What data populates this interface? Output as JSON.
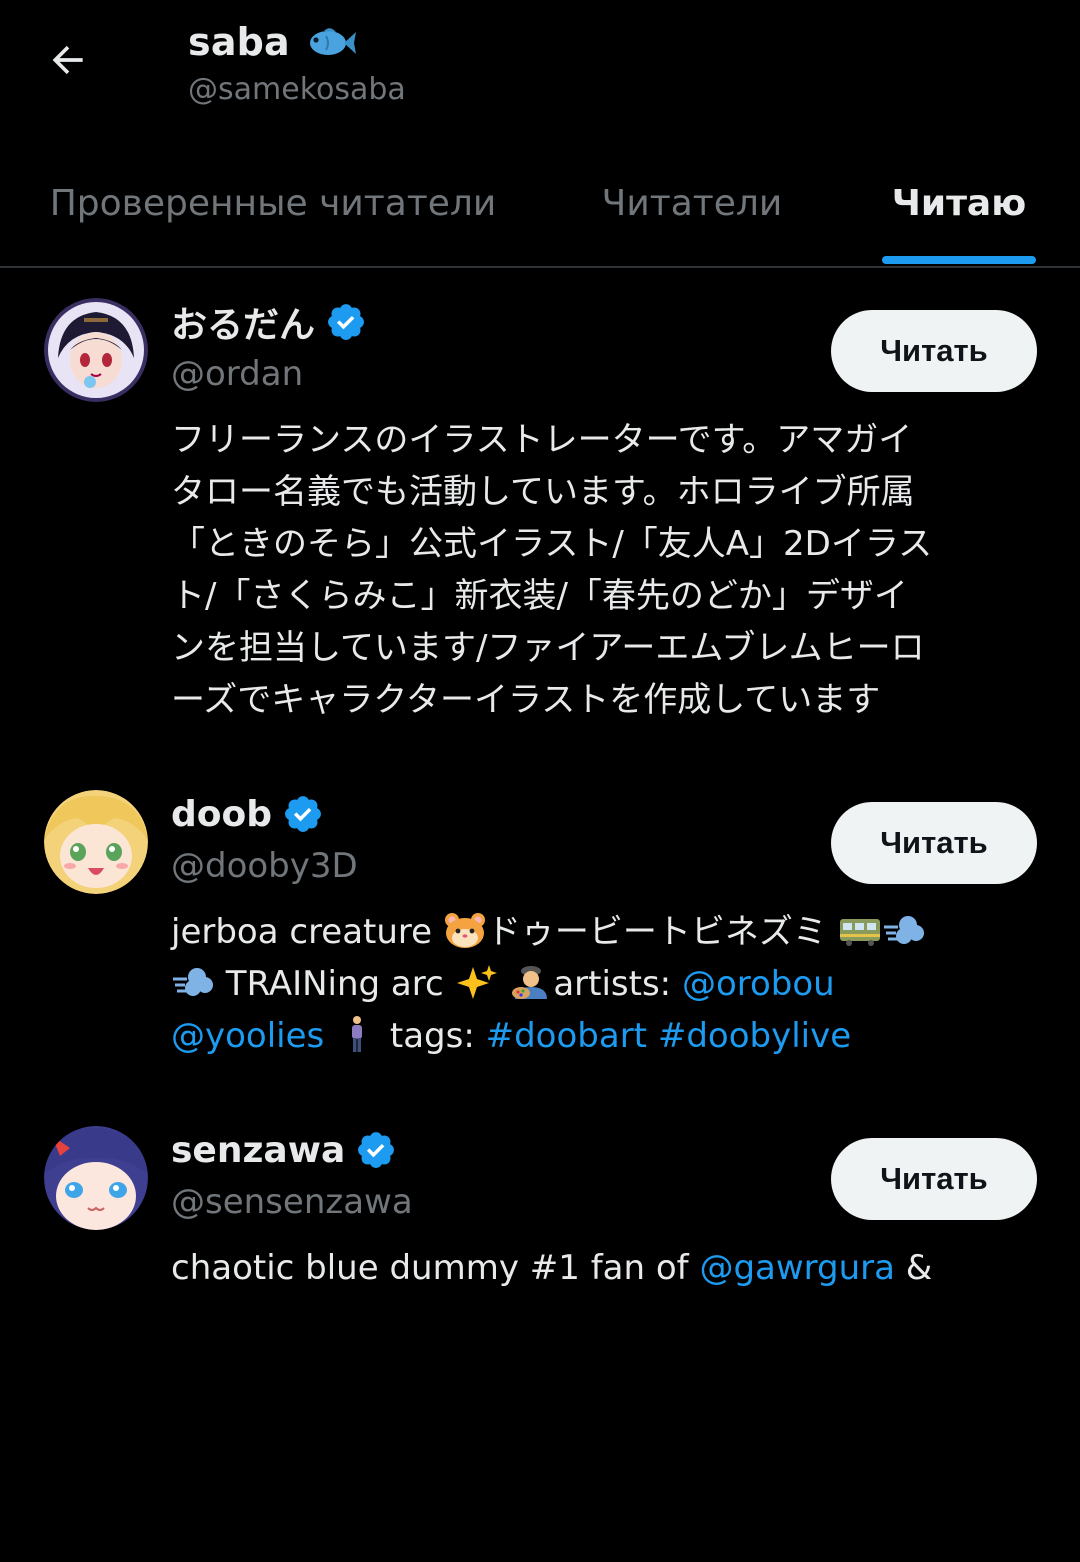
{
  "header": {
    "name": "saba",
    "name_emoji": "fish-emoji",
    "handle": "@samekosaba"
  },
  "tabs": [
    {
      "label": "Проверенные читатели",
      "active": false
    },
    {
      "label": "Читатели",
      "active": false
    },
    {
      "label": "Читаю",
      "active": true
    }
  ],
  "users": [
    {
      "name": "おるだん",
      "handle": "@ordan",
      "verified": true,
      "button": "Читать",
      "bio_lines": [
        "フリーランスのイラストレーターです。アマガイ",
        "タロー名義でも活動しています。ホロライブ所属",
        "「ときのそら」公式イラスト/「友人A」2Dイラス",
        "ト/「さくらみこ」新衣装/「春先のどか」デザイ",
        "ンを担当しています/ファイアーエムブレムヒーロ",
        "ーズでキャラクターイラストを作成しています"
      ]
    },
    {
      "name": "doob",
      "handle": "@dooby3D",
      "verified": true,
      "button": "Читать",
      "bio": {
        "t1": "jerboa creature ",
        "t2": "ドゥービートビネズミ ",
        "t3": " TRAINing arc ",
        "t4": "artists: ",
        "link1": "@orobou",
        "link2": "@yoolies",
        "t5": " tags: ",
        "link3": "#doobart",
        "link4": "#doobylive"
      }
    },
    {
      "name": "senzawa",
      "handle": "@sensenzawa",
      "verified": true,
      "button": "Читать",
      "bio": {
        "t1": "chaotic blue dummy #1 fan of ",
        "link1": "@gawrgura",
        "t2": " &"
      }
    }
  ],
  "colors": {
    "background": "#000000",
    "accent": "#1d9bf0",
    "secondary_text": "#71767b",
    "button_bg": "#eff3f4"
  }
}
